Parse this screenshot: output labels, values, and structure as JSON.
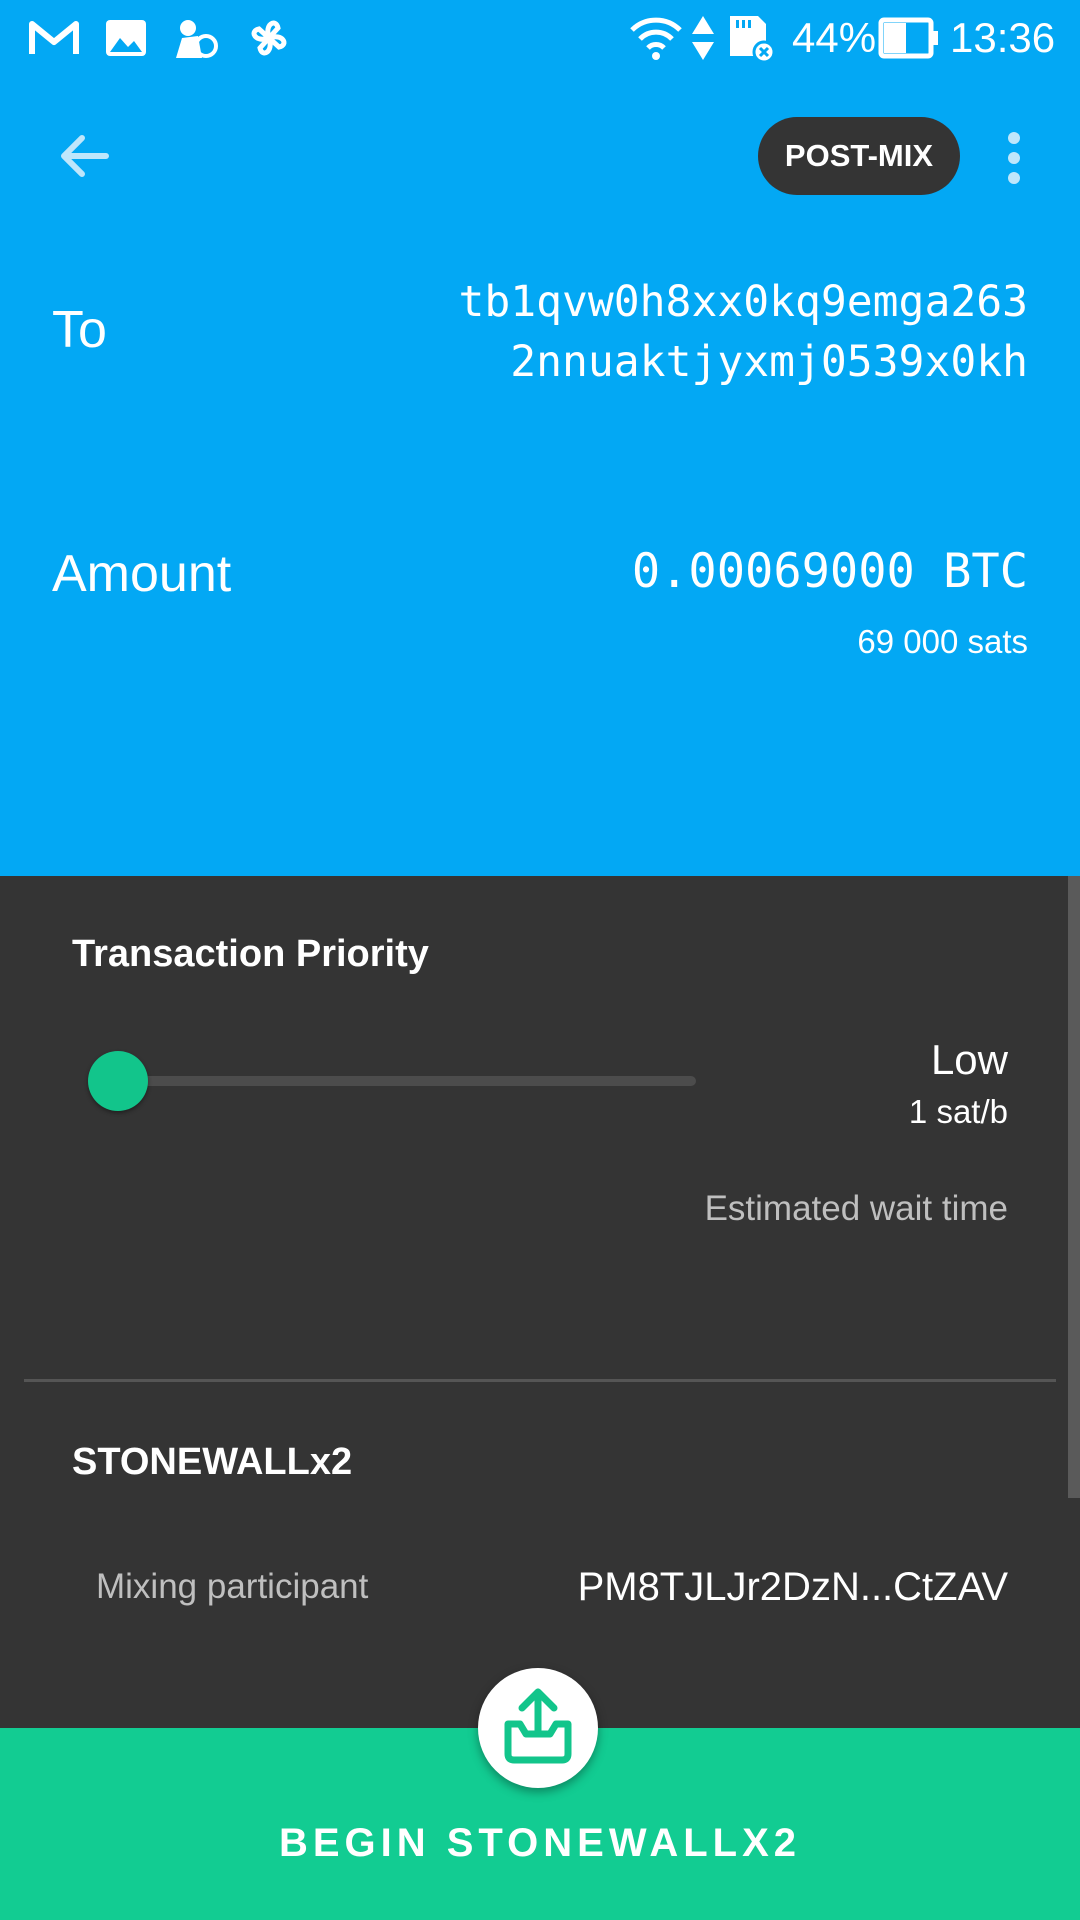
{
  "status_bar": {
    "battery_percent": "44%",
    "time": "13:36",
    "icons": [
      "gmail-icon",
      "image-icon",
      "app-icon",
      "pinwheel-icon",
      "wifi-icon",
      "data-arrows-icon",
      "sd-card-icon",
      "battery-icon"
    ]
  },
  "app_bar": {
    "back_icon": "arrow-back-icon",
    "account_chip": "POST-MIX",
    "menu_icon": "more-vert-icon"
  },
  "to": {
    "label": "To",
    "address_line1": "tb1qvw0h8xx0kq9emga263",
    "address_line2": "2nnuaktjyxmj0539x0kh"
  },
  "amount": {
    "label": "Amount",
    "btc": "0.00069000 BTC",
    "sats": "69 000 sats"
  },
  "priority": {
    "title": "Transaction Priority",
    "level": "Low",
    "fee_rate": "1 sat/b",
    "slider_value": 0,
    "wait_label": "Estimated wait time"
  },
  "stonewall": {
    "title": "STONEWALLx2",
    "participant_label": "Mixing participant",
    "participant_value": "PM8TJLJr2DzN...CtZAV"
  },
  "action": {
    "fab_icon": "upload-tray-icon",
    "button_label": "BEGIN STONEWALLX2"
  },
  "colors": {
    "header_blue": "#03a8f4",
    "card_dark": "#343434",
    "accent_green": "#12cc92"
  }
}
